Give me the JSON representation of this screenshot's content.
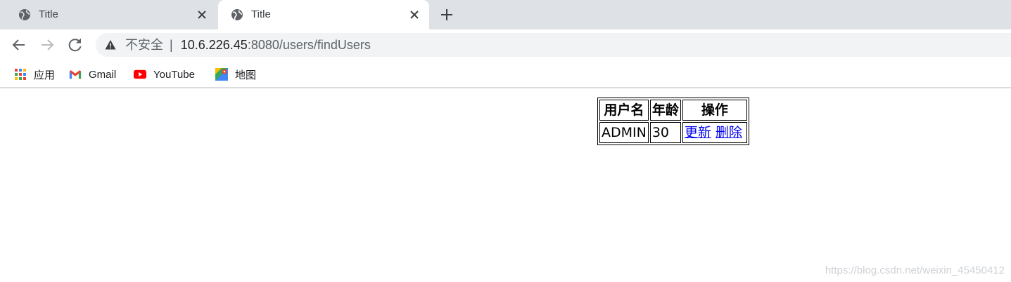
{
  "tabs": [
    {
      "title": "Title",
      "active": false
    },
    {
      "title": "Title",
      "active": true
    }
  ],
  "toolbar": {
    "security_label": "不安全",
    "separator": "|",
    "url_host": "10.6.226.45",
    "url_rest": ":8080/users/findUsers"
  },
  "bookmarks": [
    {
      "label": "应用",
      "icon": "apps-grid-icon"
    },
    {
      "label": "Gmail",
      "icon": "gmail-icon"
    },
    {
      "label": "YouTube",
      "icon": "youtube-icon"
    },
    {
      "label": "地图",
      "icon": "maps-icon"
    }
  ],
  "table": {
    "headers": [
      "用户名",
      "年龄",
      "操作"
    ],
    "rows": [
      {
        "username": "ADMIN",
        "age": "30",
        "update_label": "更新",
        "delete_label": "删除"
      }
    ]
  },
  "watermark": "https://blog.csdn.net/weixin_45450412",
  "colors": {
    "tabstrip": "#dee1e6",
    "omnibox": "#f1f3f4",
    "link": "#0000ee"
  }
}
